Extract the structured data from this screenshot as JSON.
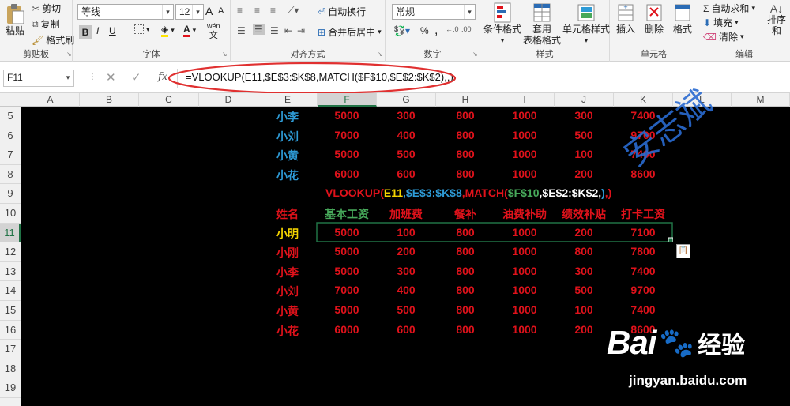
{
  "ribbon": {
    "clipboard": {
      "paste": "粘贴",
      "cut": "剪切",
      "copy": "复制",
      "painter": "格式刷",
      "label": "剪贴板"
    },
    "font": {
      "name": "等线",
      "size": "12",
      "label": "字体",
      "bold": "B",
      "italic": "I",
      "underline": "U",
      "grow": "A",
      "shrink": "A",
      "wen": "wén"
    },
    "align": {
      "wrap": "自动换行",
      "merge": "合并后居中",
      "label": "对齐方式"
    },
    "number": {
      "format": "常规",
      "percent": "%",
      "comma": ",",
      "label": "数字"
    },
    "styles": {
      "cond": "条件格式",
      "table1": "套用",
      "table2": "表格格式",
      "cell": "单元格样式",
      "label": "样式"
    },
    "cells": {
      "insert": "插入",
      "delete": "删除",
      "format": "格式",
      "label": "单元格"
    },
    "edit": {
      "autosum": "自动求和",
      "fill": "填充",
      "clear": "清除",
      "sort": "排序和",
      "label": "编辑"
    }
  },
  "formula_bar": {
    "name_box": "F11",
    "fx": "fx",
    "formula": "=VLOOKUP(E11,$E$3:$K$8,MATCH($F$10,$E$2:$K$2),,)"
  },
  "columns": [
    "A",
    "B",
    "C",
    "D",
    "E",
    "F",
    "G",
    "H",
    "I",
    "J",
    "K",
    "L",
    "M"
  ],
  "rows": [
    "5",
    "6",
    "7",
    "8",
    "9",
    "10",
    "11",
    "12",
    "13",
    "14",
    "15",
    "16",
    "17",
    "18",
    "19"
  ],
  "colors": {
    "accent": "#217346",
    "blue": "#2e9bd6",
    "red": "#e0121b",
    "yellow": "#f5d400",
    "green": "#47a85a",
    "ellipse": "#e03030",
    "watermark": "#2a6bd1"
  },
  "top_table": [
    [
      "小李",
      "5000",
      "300",
      "800",
      "1000",
      "300",
      "7400"
    ],
    [
      "小刘",
      "7000",
      "400",
      "800",
      "1000",
      "500",
      "9700"
    ],
    [
      "小黄",
      "5000",
      "500",
      "800",
      "1000",
      "100",
      "7400"
    ],
    [
      "小花",
      "6000",
      "600",
      "800",
      "1000",
      "200",
      "8600"
    ]
  ],
  "formula_display": [
    "VLOOKUP(",
    "E11",
    ",$E$3:$K$8",
    ",MATCH(",
    "$F$10",
    ",$E$2:$K$2,",
    ")",
    ",)"
  ],
  "header_row": [
    "姓名",
    "基本工资",
    "加班费",
    "餐补",
    "油费补助",
    "绩效补贴",
    "打卡工资"
  ],
  "bottom_table": [
    [
      "小明",
      "5000",
      "100",
      "800",
      "1000",
      "200",
      "7100"
    ],
    [
      "小刚",
      "5000",
      "200",
      "800",
      "1000",
      "800",
      "7800"
    ],
    [
      "小李",
      "5000",
      "300",
      "800",
      "1000",
      "300",
      "7400"
    ],
    [
      "小刘",
      "7000",
      "400",
      "800",
      "1000",
      "500",
      "9700"
    ],
    [
      "小黄",
      "5000",
      "500",
      "800",
      "1000",
      "100",
      "7400"
    ],
    [
      "小花",
      "6000",
      "600",
      "800",
      "1000",
      "200",
      "8600"
    ]
  ],
  "watermark": {
    "signature": "安志斌",
    "brand": "Bai",
    "brand2": "经验",
    "url": "jingyan.baidu.com"
  }
}
